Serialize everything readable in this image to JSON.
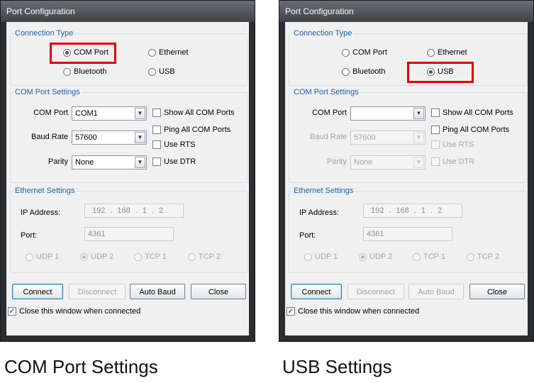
{
  "left": {
    "title": "Port Configuration",
    "connection_type": {
      "legend": "Connection Type",
      "com_port": "COM Port",
      "ethernet": "Ethernet",
      "bluetooth": "Bluetooth",
      "usb": "USB",
      "selected": "COM Port"
    },
    "com_port_settings": {
      "legend": "COM Port Settings",
      "com_port_label": "COM Port",
      "com_port_value": "COM1",
      "baud_rate_label": "Baud Rate",
      "baud_rate_value": "57600",
      "parity_label": "Parity",
      "parity_value": "None",
      "show_all_com_ports": "Show All COM Ports",
      "ping_all_com_ports": "Ping All COM Ports",
      "use_rts": "Use RTS",
      "use_dtr": "Use DTR"
    },
    "ethernet_settings": {
      "legend": "Ethernet Settings",
      "ip_label": "IP Address:",
      "ip": [
        "192",
        "168",
        "1",
        "2"
      ],
      "port_label": "Port:",
      "port_value": "4361",
      "udp1": "UDP 1",
      "udp2": "UDP 2",
      "tcp1": "TCP 1",
      "tcp2": "TCP 2"
    },
    "buttons": {
      "connect": "Connect",
      "disconnect": "Disconnect",
      "auto_baud": "Auto Baud",
      "close": "Close"
    },
    "close_when_connected": "Close this window when connected",
    "caption": "COM Port Settings"
  },
  "right": {
    "title": "Port Configuration",
    "connection_type": {
      "legend": "Connection Type",
      "com_port": "COM Port",
      "ethernet": "Ethernet",
      "bluetooth": "Bluetooth",
      "usb": "USB",
      "selected": "USB"
    },
    "com_port_settings": {
      "legend": "COM Port Settings",
      "com_port_label": "COM Port",
      "com_port_value": "",
      "baud_rate_label": "Baud Rate",
      "baud_rate_value": "57600",
      "parity_label": "Parity",
      "parity_value": "None",
      "show_all_com_ports": "Show All COM Ports",
      "ping_all_com_ports": "Ping All COM Ports",
      "use_rts": "Use RTS",
      "use_dtr": "Use DTR"
    },
    "ethernet_settings": {
      "legend": "Ethernet Settings",
      "ip_label": "IP Address:",
      "ip": [
        "192",
        "168",
        "1",
        "2"
      ],
      "port_label": "Port:",
      "port_value": "4361",
      "udp1": "UDP 1",
      "udp2": "UDP 2",
      "tcp1": "TCP 1",
      "tcp2": "TCP 2"
    },
    "buttons": {
      "connect": "Connect",
      "disconnect": "Disconnect",
      "auto_baud": "Auto Baud",
      "close": "Close"
    },
    "close_when_connected": "Close this window when connected",
    "caption": "USB Settings"
  },
  "colors": {
    "highlight": "#e00000",
    "legend_text": "#1f5fa8",
    "window_frame": "#2b2d30"
  },
  "icons": {
    "dropdown": "chevron-down-icon",
    "check": "checkmark-icon"
  }
}
